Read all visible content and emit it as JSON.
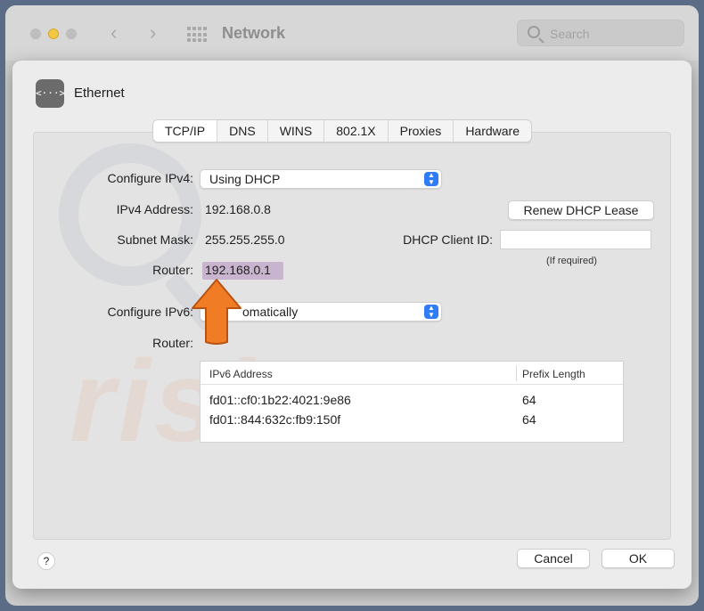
{
  "window": {
    "title": "Network"
  },
  "search": {
    "placeholder": "Search"
  },
  "sheet": {
    "interface_name": "Ethernet"
  },
  "tabs": [
    {
      "label": "TCP/IP",
      "active": true
    },
    {
      "label": "DNS",
      "active": false
    },
    {
      "label": "WINS",
      "active": false
    },
    {
      "label": "802.1X",
      "active": false
    },
    {
      "label": "Proxies",
      "active": false
    },
    {
      "label": "Hardware",
      "active": false
    }
  ],
  "ipv4": {
    "configure_label": "Configure IPv4:",
    "configure_value": "Using DHCP",
    "address_label": "IPv4 Address:",
    "address_value": "192.168.0.8",
    "subnet_label": "Subnet Mask:",
    "subnet_value": "255.255.255.0",
    "router_label": "Router:",
    "router_value": "192.168.0.1",
    "renew_button": "Renew DHCP Lease",
    "client_id_label": "DHCP Client ID:",
    "client_id_value": "",
    "client_id_hint": "(If required)"
  },
  "ipv6": {
    "configure_label": "Configure IPv6:",
    "configure_value": "omatically",
    "router_label": "Router:",
    "table": {
      "columns": [
        "IPv6 Address",
        "Prefix Length"
      ],
      "rows": [
        [
          "fd01::cf0:1b22:4021:9e86",
          "64"
        ],
        [
          "fd01::844:632c:fb9:150f",
          "64"
        ]
      ]
    }
  },
  "footer": {
    "help_label": "?",
    "cancel_label": "Cancel",
    "ok_label": "OK"
  },
  "watermark": {
    "text": "rish.com"
  },
  "icons": {
    "ethernet": "ethernet-icon",
    "search": "search-icon",
    "back": "chevron-left-icon",
    "forward": "chevron-right-icon",
    "grid": "grid-icon",
    "popup": "up-down-chevron-icon",
    "annotation": "up-arrow-icon"
  },
  "colors": {
    "accent": "#2f7cf6",
    "highlight": "#c9b4cf",
    "arrow": "#f07c26",
    "minimize_light": "#f2c744"
  }
}
